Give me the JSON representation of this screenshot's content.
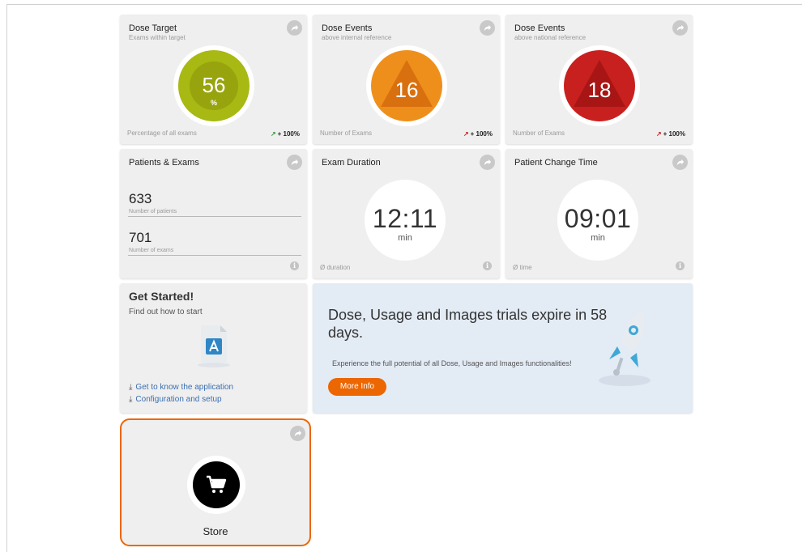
{
  "colors": {
    "accent": "#ec6602",
    "green": "#a7b912",
    "orange": "#ef8f1b",
    "red": "#c8201e"
  },
  "dose_target": {
    "title": "Dose Target",
    "subtitle": "Exams within target",
    "value": "56",
    "unit": "%",
    "footer_label": "Percentage of all exams",
    "trend": "+ 100%",
    "trend_icon": "arrow-up-green-icon"
  },
  "dose_events_internal": {
    "title": "Dose Events",
    "subtitle": "above internal reference",
    "value": "16",
    "footer_label": "Number of Exams",
    "trend": "+ 100%",
    "trend_icon": "arrow-up-red-icon"
  },
  "dose_events_national": {
    "title": "Dose Events",
    "subtitle": "above national reference",
    "value": "18",
    "footer_label": "Number of Exams",
    "trend": "+ 100%",
    "trend_icon": "arrow-up-red-icon"
  },
  "patients_exams": {
    "title": "Patients & Exams",
    "patients_value": "633",
    "patients_label": "Number of patients",
    "exams_value": "701",
    "exams_label": "Number of exams"
  },
  "exam_duration": {
    "title": "Exam Duration",
    "value": "12:11",
    "unit": "min",
    "footer_label": "Ø duration"
  },
  "patient_change": {
    "title": "Patient Change Time",
    "value": "09:01",
    "unit": "min",
    "footer_label": "Ø time"
  },
  "get_started": {
    "title": "Get Started!",
    "subtitle": "Find out how to start",
    "link1": "Get to know the application",
    "link2": "Configuration and setup"
  },
  "promo": {
    "title": "Dose, Usage and Images trials expire in 58 days.",
    "text": "Experience the full potential of all Dose, Usage and Images functionalities!",
    "button": "More Info"
  },
  "store": {
    "label": "Store"
  }
}
